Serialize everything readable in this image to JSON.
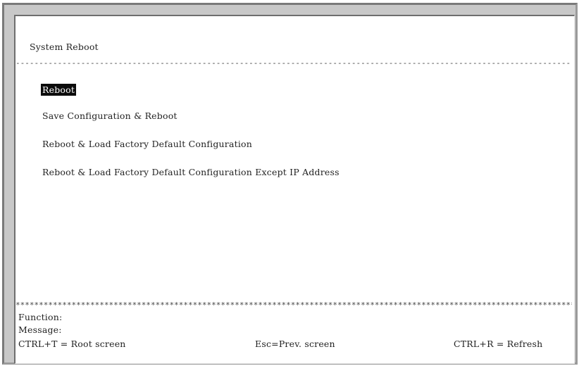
{
  "screen": {
    "title": "System Reboot",
    "dash_separator": "----------------------------------------------------------------------------------------------------------------------------------------------------------",
    "star_separator": "**************************************************************************************************************************************************"
  },
  "menu": {
    "items": [
      {
        "label": "Reboot",
        "selected": true
      },
      {
        "label": "Save Configuration & Reboot",
        "selected": false
      },
      {
        "label": "Reboot & Load Factory Default Configuration",
        "selected": false
      },
      {
        "label": "Reboot & Load Factory Default Configuration Except IP Address",
        "selected": false
      }
    ]
  },
  "status": {
    "function_label": "Function:",
    "message_label": "Message:"
  },
  "footer": {
    "root_hint": "CTRL+T = Root screen",
    "prev_hint": "Esc=Prev. screen",
    "refresh_hint": "CTRL+R = Refresh"
  }
}
